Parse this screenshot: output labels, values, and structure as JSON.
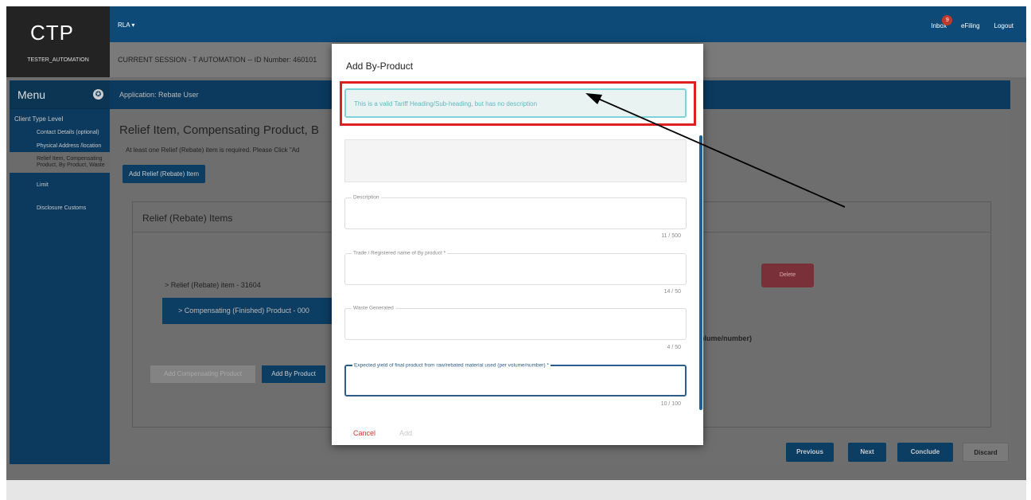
{
  "header": {
    "logo": "CTP",
    "username": "TESTER_AUTOMATION",
    "role_menu": "RLA ▾",
    "inbox_label": "Inbox",
    "inbox_count": "9",
    "efiling_label": "eFiling",
    "logout_label": "Logout"
  },
  "session": {
    "text": "CURRENT SESSION - T AUTOMATION -- ID Number: 460101"
  },
  "sidebar": {
    "title": "Menu",
    "section": "Client Type Level",
    "items": [
      {
        "label": "Contact Details (optional)"
      },
      {
        "label": "Physical Address /location"
      },
      {
        "label": "Relief Item, Compensating Product, By Product, Waste"
      },
      {
        "label": "Limit"
      },
      {
        "label": "Disclosure Customs"
      }
    ]
  },
  "app_header": {
    "title": "Application: Rebate User"
  },
  "main": {
    "page_title": "Relief Item, Compensating Product, B",
    "info": "At least one Relief (Rebate) item is required. Please Click \"Ad",
    "add_relief_btn": "Add Relief (Rebate) Item",
    "card_title": "Relief (Rebate) Items",
    "relief_item": "> Relief (Rebate) item - 31604",
    "compensating_product": "> Compensating (Finished) Product - 000",
    "delete_btn": "Delete",
    "volume_text": "r volume/number)",
    "add_comp_btn": "Add Compensating Product",
    "add_by_btn": "Add By Product"
  },
  "nav": {
    "previous": "Previous",
    "next": "Next",
    "conclude": "Conclude",
    "discard": "Discard"
  },
  "modal": {
    "title": "Add By-Product",
    "alert": "This is a valid Tariff Heading/Sub-heading, but has no description",
    "description_label": "Description",
    "description_counter": "11 / 500",
    "trade_label": "Trade / Registered name of By product *",
    "trade_counter": "14 / 50",
    "waste_label": "Waste Generated",
    "waste_counter": "4 / 50",
    "yield_label": "Expected yield of final product from raw/rebated material used (per volume/number) *",
    "yield_counter": "10 / 100",
    "cancel": "Cancel",
    "add": "Add"
  },
  "colors": {
    "brand_blue": "#0d4a78",
    "alert_border": "#7ed3d7",
    "highlight_red": "#e0201f",
    "delete_red": "#c94b5a"
  }
}
